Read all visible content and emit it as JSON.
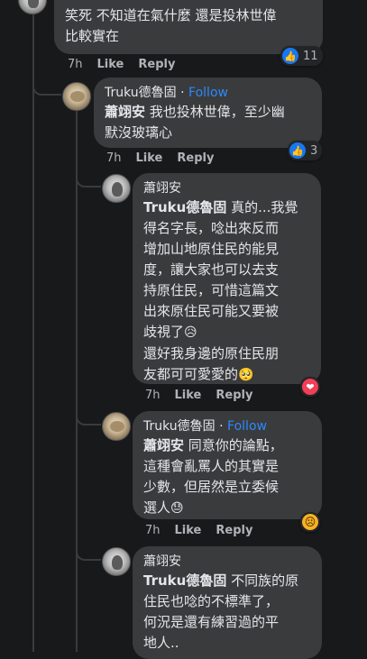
{
  "comments": [
    {
      "author": "",
      "follow": "",
      "mention": "",
      "text_lines": [
        "笑死 不知道在氣什麼 還是投林世偉",
        "比較實在"
      ],
      "time": "7h",
      "like_label": "Like",
      "reply_label": "Reply",
      "reaction_count": "11",
      "reaction_icon": "like-icon"
    },
    {
      "author": "Truku德魯固",
      "follow": "Follow",
      "separator": " · ",
      "mention": "蕭翊安",
      "text_lines": [
        " 我也投林世偉，至少幽",
        "默沒玻璃心"
      ],
      "time": "7h",
      "like_label": "Like",
      "reply_label": "Reply",
      "reaction_count": "3",
      "reaction_icon": "like-icon"
    },
    {
      "author": "蕭翊安",
      "mention": "Truku德魯固",
      "text_lines": [
        " 真的...我覺",
        "得名字長，唸出來反而",
        "增加山地原住民的能見",
        "度，讓大家也可以去支",
        "持原住民，可惜這篇文",
        "出來原住民可能又要被",
        "歧視了",
        "還好我身邊的原住民朋",
        "友都可可愛愛的"
      ],
      "emoji_a": "😥",
      "emoji_b": "🥺",
      "time": "7h",
      "like_label": "Like",
      "reply_label": "Reply",
      "reaction_icon": "love-icon"
    },
    {
      "author": "Truku德魯固",
      "follow": "Follow",
      "separator": " · ",
      "mention": "蕭翊安",
      "text_lines": [
        " 同意你的論點，",
        "這種會亂罵人的其實是",
        "少數，但居然是立委候",
        "選人"
      ],
      "emoji": "😓",
      "time": "7h",
      "like_label": "Like",
      "reply_label": "Reply",
      "reaction_icon": "sad-icon"
    },
    {
      "author": "蕭翊安",
      "mention": "Truku德魯固",
      "text_lines": [
        " 不同族的原",
        "住民也唸的不標準了，",
        "何況是還有練習過的平",
        "地人.."
      ]
    }
  ]
}
